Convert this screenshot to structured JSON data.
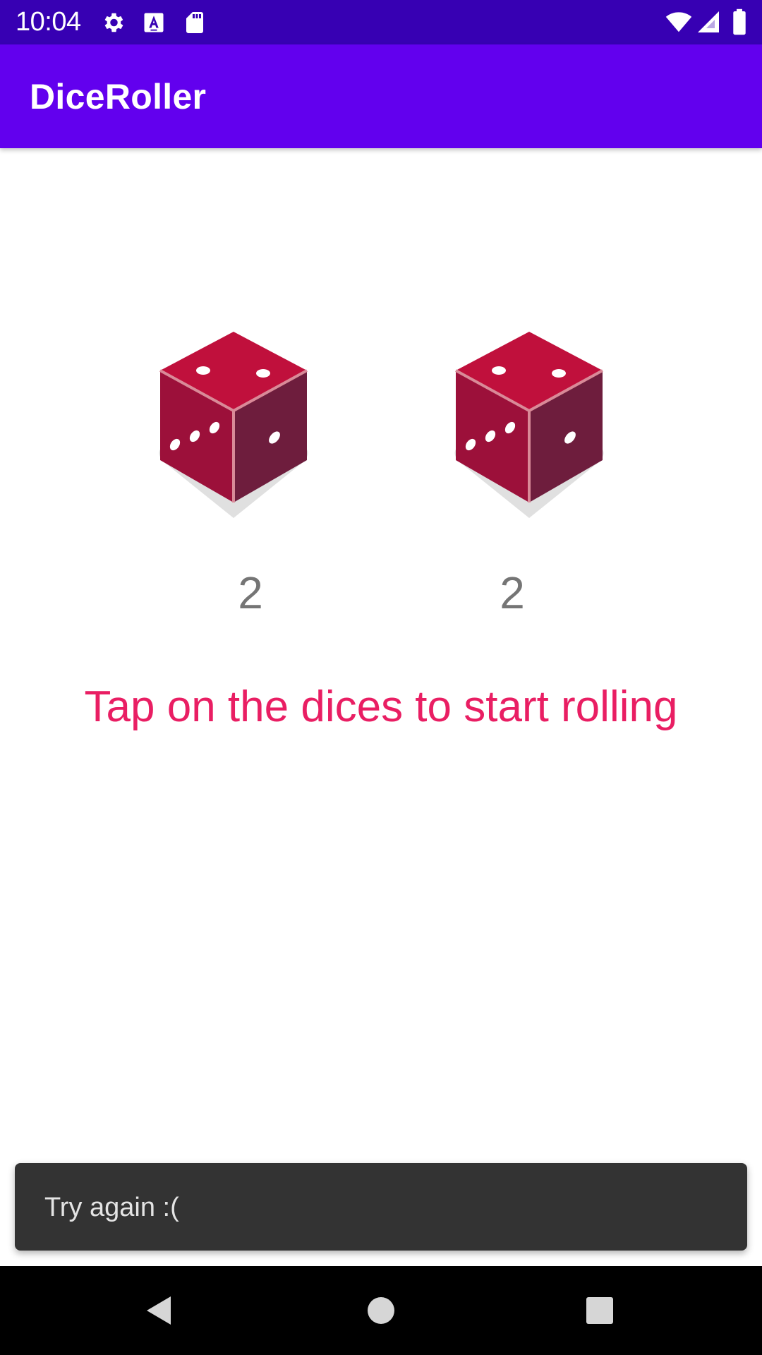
{
  "status_bar": {
    "time": "10:04",
    "left_icons": [
      "gear-icon",
      "text-a-icon",
      "sd-card-icon"
    ],
    "right_icons": [
      "wifi-icon",
      "signal-icon",
      "battery-icon"
    ]
  },
  "app_bar": {
    "title": "DiceRoller",
    "color": "#6200ee"
  },
  "dice": [
    {
      "value": "2"
    },
    {
      "value": "2"
    }
  ],
  "hint": "Tap on the dices to start rolling",
  "snackbar": {
    "message": "Try again :("
  },
  "nav_bar": {
    "buttons": [
      "back-icon",
      "home-icon",
      "recents-icon"
    ]
  },
  "colors": {
    "status_bar": "#3700b3",
    "accent": "#e91e63",
    "die_top": "#c0103c",
    "die_left": "#9c103a",
    "die_right": "#6e1d3d"
  }
}
